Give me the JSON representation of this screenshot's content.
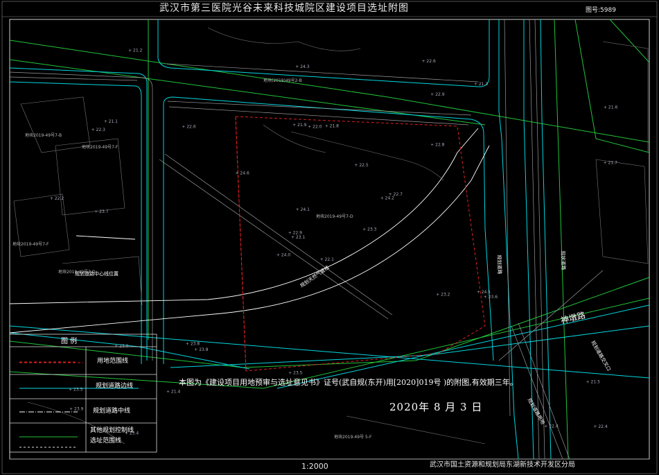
{
  "title": "武汉市第三医院光谷未来科技城院区建设项目选址附图",
  "map_number": "图号:5989",
  "scale": "1:2000",
  "bureau": "武汉市国土资源和规划局东湖新技术开发区分局",
  "notice": "本图为《建设项目用地预审与选址意见书》证号(武自规(东开)用[2020]019号 )的附图,有效期三年。",
  "date": "2020年 8 月 3 日",
  "road_name": "神墩路",
  "legend": {
    "title": "图    例",
    "items": [
      "用地范围线",
      "规划道路边线",
      "规划道路中线",
      "其他规划控制线",
      "选址范围线"
    ]
  },
  "labels": {
    "mid_road": "规划天然气管线",
    "right_road": "规划道路",
    "right_road2": "现状道路",
    "left_note": "规划道路中心线位置",
    "right_note1": "规划道路交叉口",
    "right_note2": "规划道路用地"
  },
  "block_labels": [
    "地块(2019)49号2-B",
    "地块2019-49号7-B",
    "地块2019-49号7-F",
    "地块2019-49号7-D",
    "地块2019-49号7-F",
    "地块2019-49号7-D",
    "地块2019-49号 5-F"
  ],
  "elevations": [
    "22.1",
    "22.3",
    "23.1",
    "23.5",
    "24.2",
    "23.8",
    "22.6",
    "21.8",
    "22.9",
    "23.3",
    "21.2",
    "22.4",
    "23.7",
    "21.6",
    "24.0",
    "22.8",
    "23.4",
    "21.9",
    "22.5",
    "23.0",
    "24.6",
    "23.9",
    "21.4",
    "22.0",
    "22.7",
    "23.6",
    "21.1",
    "24.3",
    "22.2",
    "23.2",
    "21.7",
    "22.9",
    "23.5",
    "24.1",
    "22.6",
    "21.3",
    "23.8",
    "22.4",
    "21.5",
    "24.5"
  ],
  "colors": {
    "background": "#000000",
    "road_edge": "#00d8e0",
    "other_control": "#22c43a",
    "site_boundary": "#e02020",
    "centerline": "#ffffff"
  }
}
